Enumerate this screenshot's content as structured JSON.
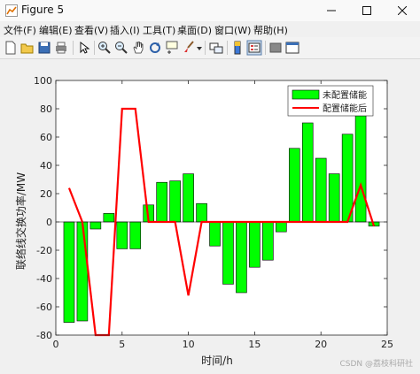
{
  "window": {
    "title": "Figure 5"
  },
  "menu": [
    "文件(F)",
    "编辑(E)",
    "查看(V)",
    "插入(I)",
    "工具(T)",
    "桌面(D)",
    "窗口(W)",
    "帮助(H)"
  ],
  "toolbar_icons": [
    "new-figure-icon",
    "open-file-icon",
    "save-icon",
    "print-icon",
    "edit-plot-icon",
    "zoom-in-icon",
    "zoom-out-icon",
    "pan-icon",
    "rotate-3d-icon",
    "data-cursor-icon",
    "brush-icon",
    "brush-dropdown-icon",
    "link-plot-icon",
    "colorbar-icon",
    "legend-icon",
    "hide-tools-icon",
    "show-tools-icon"
  ],
  "watermark": "CSDN @荔枝科研社",
  "chart_data": {
    "type": "bar",
    "xlabel": "时间/h",
    "ylabel": "联络线交换功率/MW",
    "xlim": [
      0,
      25
    ],
    "ylim": [
      -80,
      100
    ],
    "xticks": [
      "0",
      "5",
      "10",
      "15",
      "20",
      "25"
    ],
    "yticks": [
      "-80",
      "-60",
      "-40",
      "-20",
      "0",
      "20",
      "40",
      "60",
      "80",
      "100"
    ],
    "x": [
      1,
      2,
      3,
      4,
      5,
      6,
      7,
      8,
      9,
      10,
      11,
      12,
      13,
      14,
      15,
      16,
      17,
      18,
      19,
      20,
      21,
      22,
      23,
      24
    ],
    "series": [
      {
        "name": "未配置储能",
        "kind": "bar",
        "color": "#00ff00",
        "values": [
          -71,
          -70,
          -5,
          6,
          -19,
          -19,
          12,
          28,
          29,
          34,
          13,
          -17,
          -44,
          -50,
          -32,
          -27,
          -7,
          52,
          70,
          45,
          34,
          62,
          75,
          -3
        ]
      },
      {
        "name": "配置储能后",
        "kind": "line",
        "color": "#ff0000",
        "values": [
          24,
          0,
          -80,
          -80,
          80,
          80,
          0,
          0,
          0,
          -52,
          0,
          0,
          0,
          0,
          0,
          0,
          0,
          0,
          0,
          0,
          0,
          0,
          26,
          -3
        ]
      }
    ],
    "legend": "top-right",
    "grid": false
  }
}
